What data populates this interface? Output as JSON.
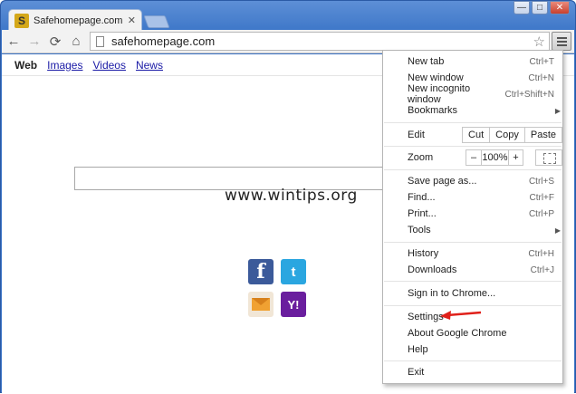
{
  "tab": {
    "favicon_letter": "S",
    "title": "Safehomepage.com",
    "close": "✕"
  },
  "window_controls": {
    "minimize": "—",
    "maximize": "□",
    "close": "✕"
  },
  "toolbar": {
    "back": "←",
    "forward": "→",
    "reload": "⟳",
    "home": "⌂",
    "url": "safehomepage.com",
    "star": "☆"
  },
  "search_nav": {
    "items": [
      "Web",
      "Images",
      "Videos",
      "News"
    ]
  },
  "watermark": "www.wintips.org",
  "social": {
    "facebook": "f",
    "twitter": "t",
    "yahoo": "Y!"
  },
  "menu": {
    "new_tab": {
      "label": "New tab",
      "shortcut": "Ctrl+T"
    },
    "new_window": {
      "label": "New window",
      "shortcut": "Ctrl+N"
    },
    "incognito": {
      "label": "New incognito window",
      "shortcut": "Ctrl+Shift+N"
    },
    "bookmarks": {
      "label": "Bookmarks"
    },
    "edit": {
      "label": "Edit",
      "cut": "Cut",
      "copy": "Copy",
      "paste": "Paste"
    },
    "zoom": {
      "label": "Zoom",
      "minus": "–",
      "value": "100%",
      "plus": "+"
    },
    "save_page": {
      "label": "Save page as...",
      "shortcut": "Ctrl+S"
    },
    "find": {
      "label": "Find...",
      "shortcut": "Ctrl+F"
    },
    "print": {
      "label": "Print...",
      "shortcut": "Ctrl+P"
    },
    "tools": {
      "label": "Tools"
    },
    "history": {
      "label": "History",
      "shortcut": "Ctrl+H"
    },
    "downloads": {
      "label": "Downloads",
      "shortcut": "Ctrl+J"
    },
    "sign_in": {
      "label": "Sign in to Chrome..."
    },
    "settings": {
      "label": "Settings"
    },
    "about": {
      "label": "About Google Chrome"
    },
    "help": {
      "label": "Help"
    },
    "exit": {
      "label": "Exit"
    }
  },
  "colors": {
    "chrome_blue": "#3a73c6",
    "annotation_red": "#e0201a",
    "facebook": "#3b5a9a",
    "twitter": "#2aa6e0",
    "yahoo": "#6a1e9e"
  }
}
